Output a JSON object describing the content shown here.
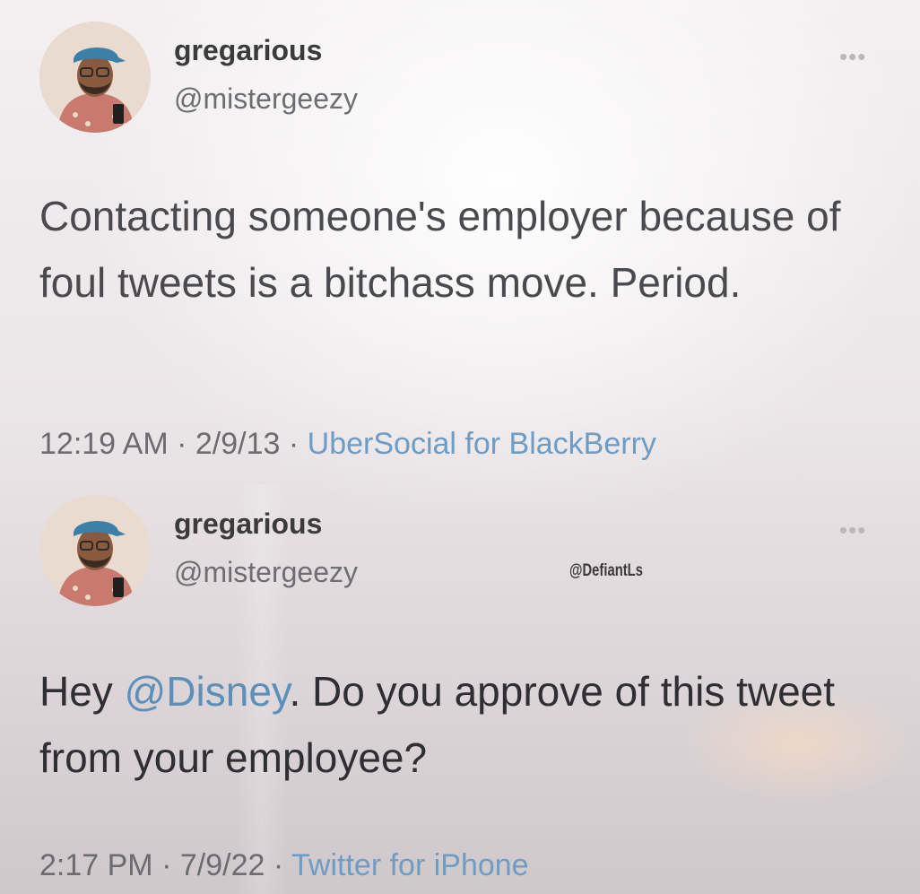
{
  "colors": {
    "link": "#5d8fb8",
    "name_text": "#3b3b3d",
    "secondary_text": "#6e6e72"
  },
  "watermark": "@DefiantLs",
  "tweets": [
    {
      "display_name": "gregarious",
      "handle": "@mistergeezy",
      "more_icon": "more-dots-icon",
      "text_parts": [
        "Contacting someone's employer because of foul tweets is a bitchass move. Period."
      ],
      "time": "12:19 AM",
      "separator": "·",
      "date": "2/9/13",
      "source": "UberSocial for BlackBerry"
    },
    {
      "display_name": "gregarious",
      "handle": "@mistergeezy",
      "more_icon": "more-dots-icon",
      "text_before": "Hey ",
      "mention": "@Disney",
      "text_after": ". Do you approve of this tweet from your employee?",
      "time": "2:17 PM",
      "separator": "·",
      "date": "7/9/22",
      "source": "Twitter for iPhone"
    }
  ]
}
